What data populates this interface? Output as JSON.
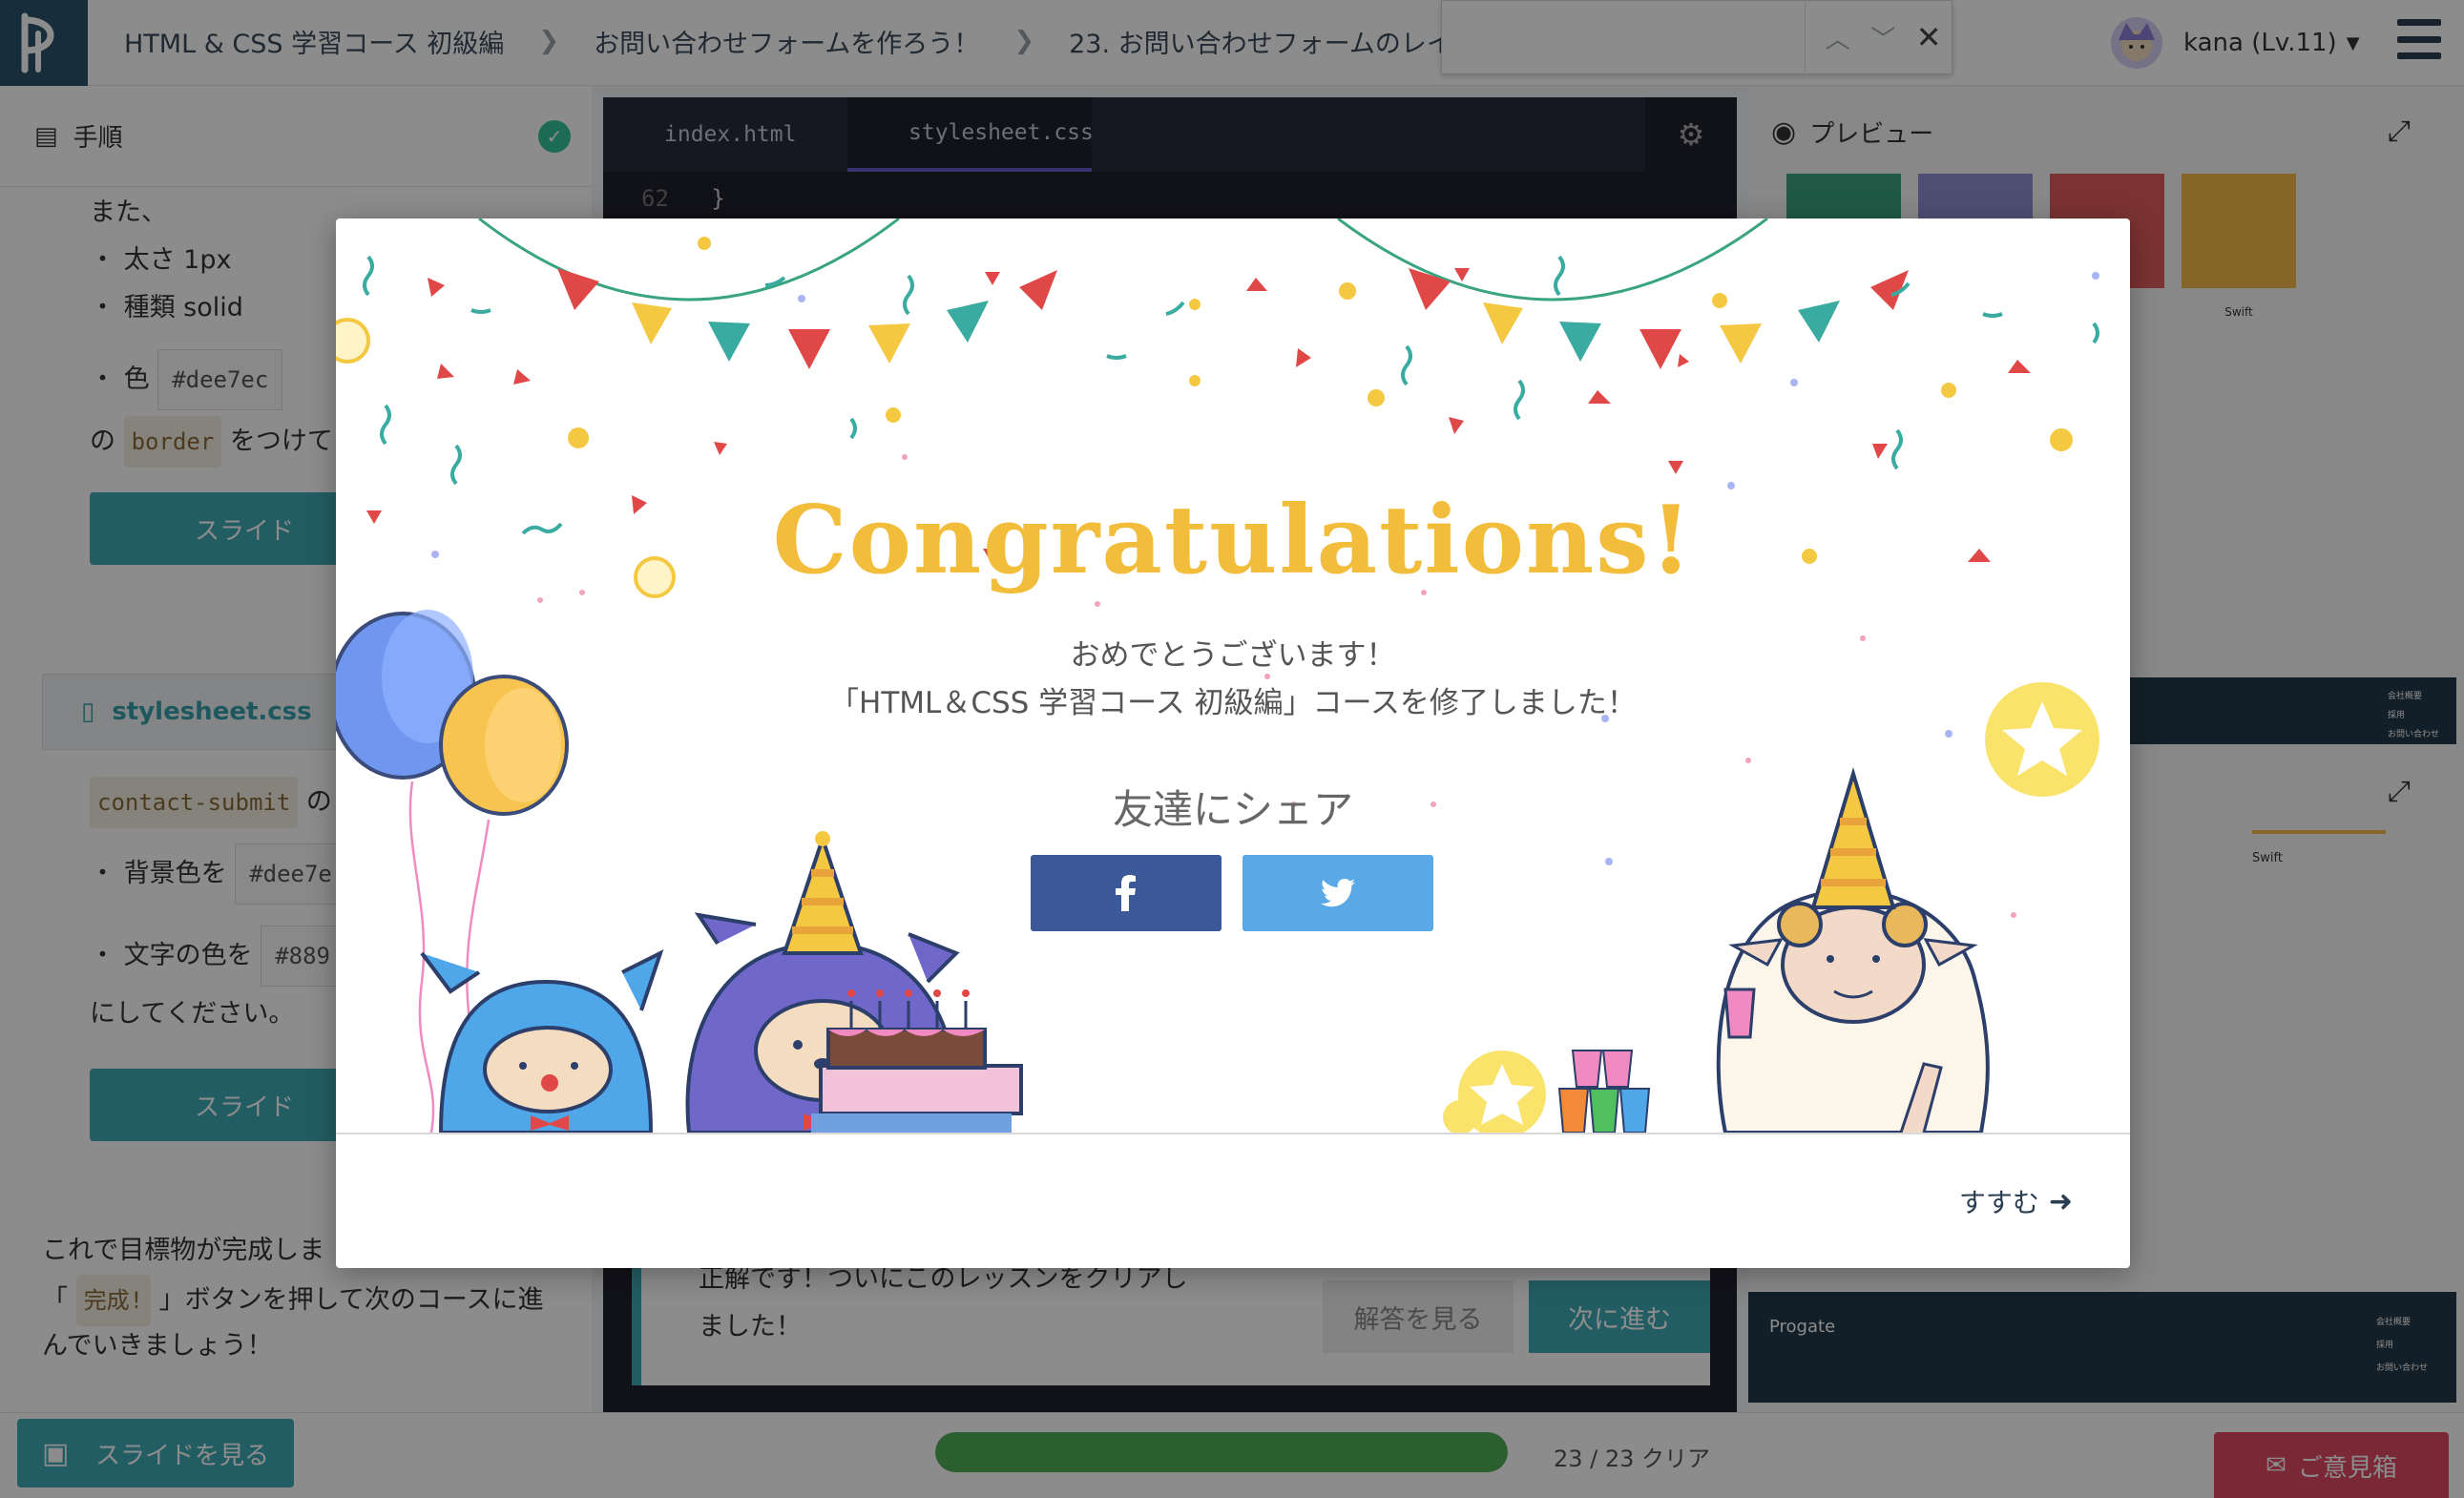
{
  "header": {
    "breadcrumb": [
      "HTML & CSS 学習コース 初級編",
      "お問い合わせフォームを作ろう！",
      "23. お問い合わせフォームのレイ"
    ],
    "user": "kana (Lv.11)"
  },
  "find": {
    "value": ""
  },
  "left_pane": {
    "title": "手順",
    "step_lines": [
      "また、",
      "・ 太さ 1px",
      "・ 種類 solid"
    ],
    "color_label": "・ 色",
    "color_value": "#dee7ec",
    "border_prefix": "の",
    "border_code": "border",
    "border_suffix": "をつけて",
    "slide_button": "スライド",
    "file_card": "stylesheet.css",
    "submit_code": "contact-submit",
    "submit_suffix": "の",
    "bg_label": "・ 背景色を",
    "bg_value": "#dee7e",
    "text_label": "・ 文字の色を",
    "text_value": "#889",
    "end_line": "にしてください。",
    "slide_button2": "スライド",
    "bottom_line1": "これで目標物が完成しま",
    "bottom_line2_prefix": "「",
    "bottom_code": "完成!",
    "bottom_line2_suffix": "」ボタンを押して次のコースに進",
    "bottom_line3": "んでいきましょう！"
  },
  "editor": {
    "tabs": [
      "index.html",
      "stylesheet.css"
    ],
    "line_number": "62",
    "line_code": "}",
    "hint_line1": "正解です！ついにこのレッスンをクリアし",
    "hint_line2": "ました！",
    "answer_button": "解答を見る",
    "next_button": "次に進む"
  },
  "preview": {
    "title": "プレビュー",
    "thumb_label": "Swift",
    "chart_label": "Swift",
    "nav_items": [
      "会社概要",
      "採用",
      "お問い合わせ"
    ],
    "footer_brand": "Progate"
  },
  "footer": {
    "slide_button": "スライドを見る",
    "progress": 1.0,
    "count": "23 / 23 クリア",
    "feedback": "ご意見箱"
  },
  "modal": {
    "title": "Congratulations!",
    "message1": "おめでとうございます！",
    "message2": "「HTML＆CSS 学習コース 初級編」コースを修了しました！",
    "share_title": "友達にシェア",
    "next": "すすむ"
  },
  "colors": {
    "accent": "#3eaab5",
    "gold": "#f2bd3a",
    "facebook": "#3b5998",
    "twitter": "#5ba8e6",
    "progress": "#4fae57",
    "feedback": "#de4a63"
  }
}
